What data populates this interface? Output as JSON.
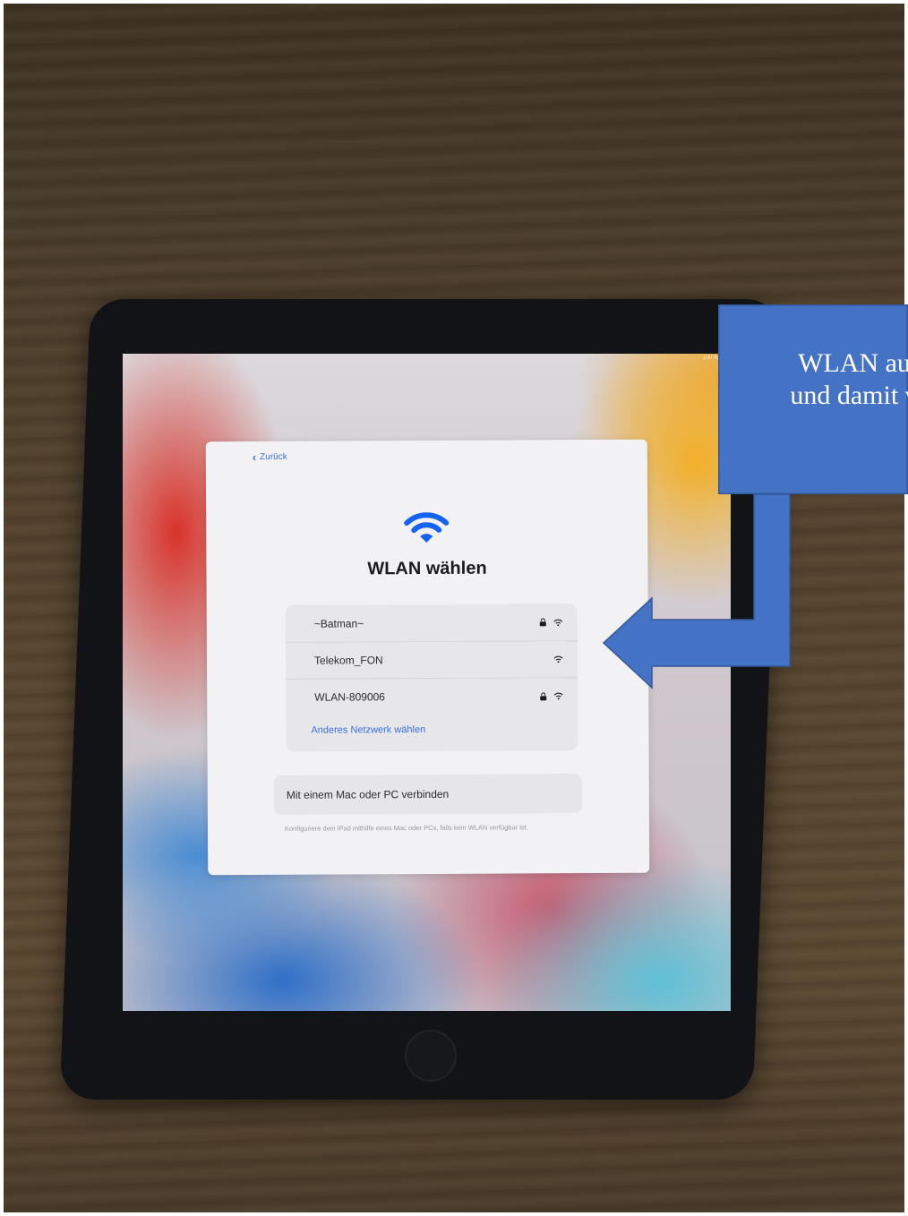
{
  "status_bar": {
    "battery_text": "100 %"
  },
  "setup_sheet": {
    "back_label": "Zurück",
    "title": "WLAN wählen",
    "networks": [
      {
        "name": "~Batman~",
        "secured": true
      },
      {
        "name": "Telekom_FON",
        "secured": false
      },
      {
        "name": "WLAN-809006",
        "secured": true
      }
    ],
    "other_network_label": "Anderes Netzwerk wählen",
    "mac_pc_label": "Mit einem Mac oder PC verbinden",
    "hint": "Konfiguriere dein iPad mithilfe eines Mac oder PCs, falls kein WLAN verfügbar ist."
  },
  "annotation": {
    "callout_line1": "WLAN au",
    "callout_line2": "und damit v",
    "color": "#4472c4"
  },
  "icons": {
    "wifi": "wifi-icon",
    "lock": "lock-icon",
    "back": "chevron-left-icon"
  }
}
